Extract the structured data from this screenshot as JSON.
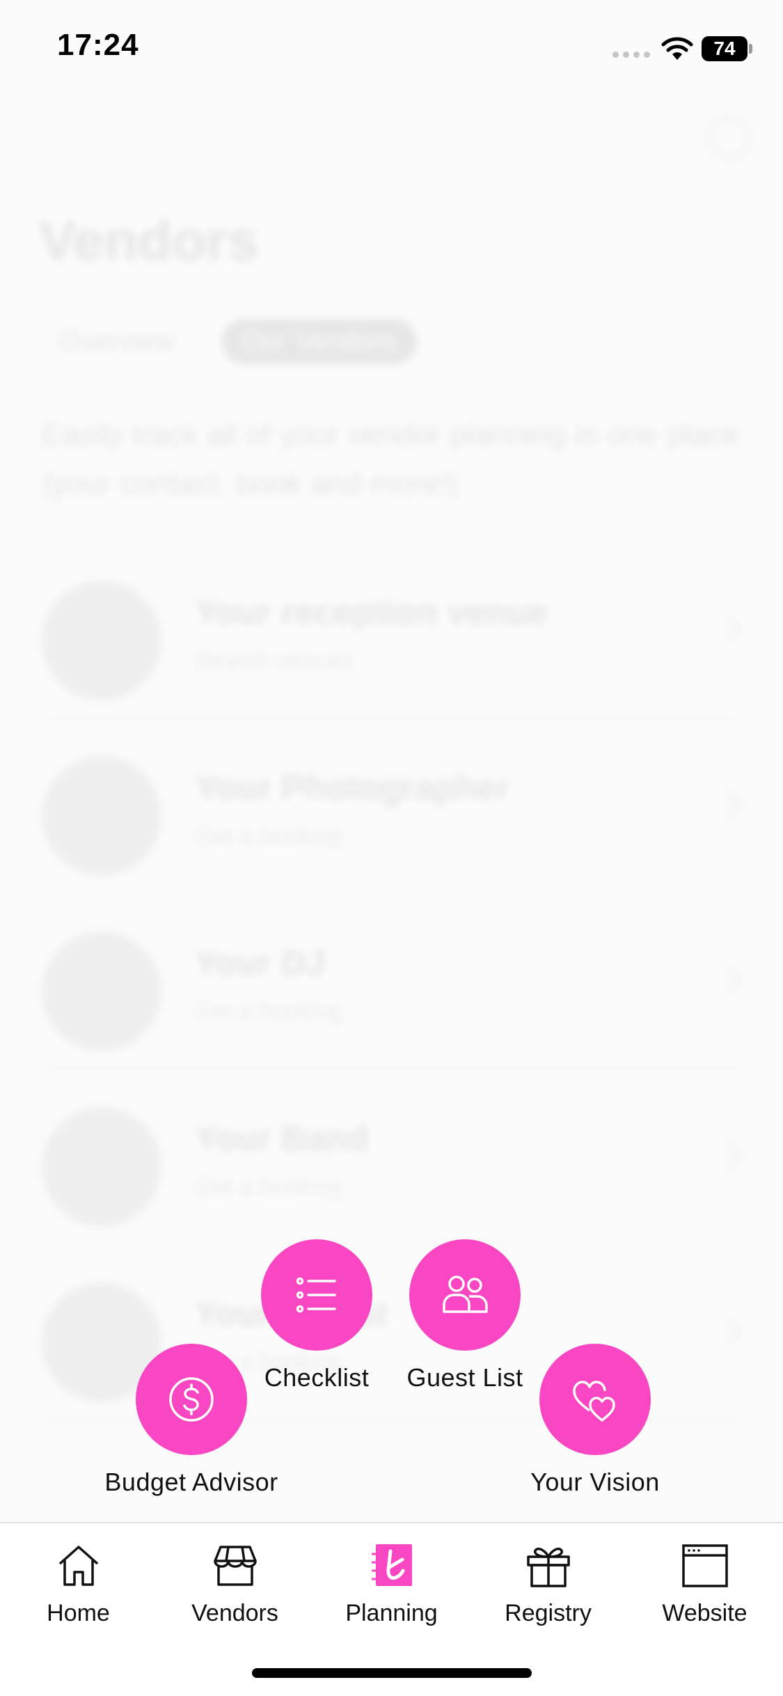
{
  "status_bar": {
    "time": "17:24",
    "battery": "74",
    "icons": [
      "cellular-icon",
      "wifi-icon",
      "battery-icon"
    ]
  },
  "background_screen": {
    "title": "Vendors",
    "tabs": [
      "Overview",
      "Our Vendors"
    ],
    "intro": "Easily track all of your vendor planning in one place (your contact, book and more!)",
    "vendors": [
      {
        "title": "Your reception venue",
        "subtitle": "Search venues"
      },
      {
        "title": "Your Photographer",
        "subtitle": "Get a booking"
      },
      {
        "title": "Your DJ",
        "subtitle": "Get a booking"
      },
      {
        "title": "Your Band",
        "subtitle": "Get a booking"
      },
      {
        "title": "Your Florist",
        "subtitle": "Get a booking"
      }
    ]
  },
  "quick_actions": {
    "checklist": "Checklist",
    "guest_list": "Guest List",
    "budget_advisor": "Budget Advisor",
    "your_vision": "Your Vision",
    "accent_color": "#f946c2"
  },
  "tabbar": {
    "home": "Home",
    "vendors": "Vendors",
    "planning": "Planning",
    "registry": "Registry",
    "website": "Website",
    "active": "planning"
  }
}
